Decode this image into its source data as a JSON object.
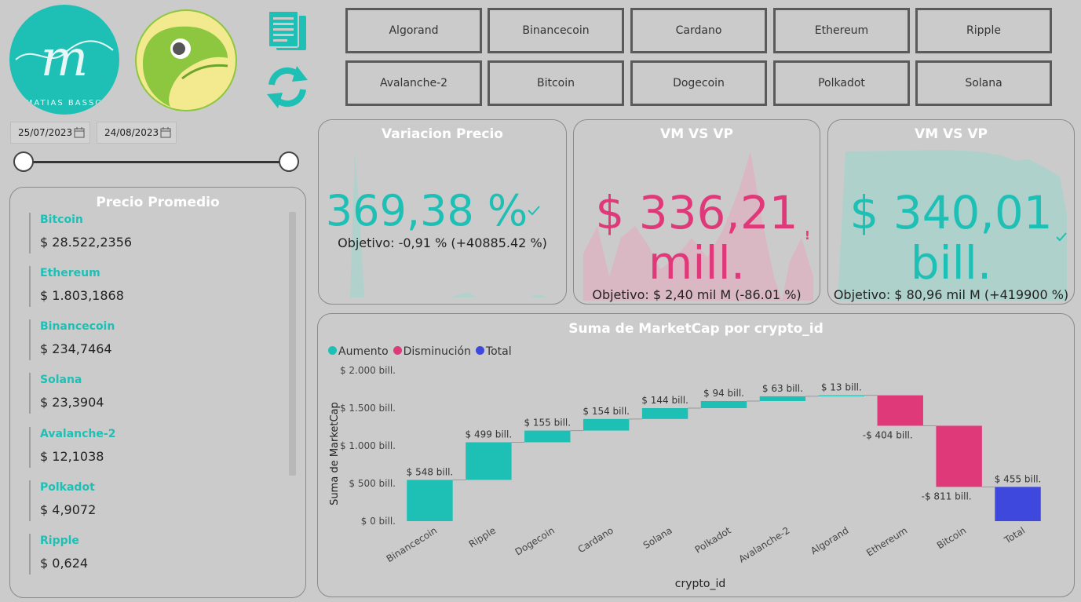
{
  "logos": {
    "author_text": "MATIAS BASSO",
    "author_initial": "m"
  },
  "crypto_buttons": {
    "row1": [
      "Algorand",
      "Binancecoin",
      "Cardano",
      "Ethereum",
      "Ripple"
    ],
    "row2": [
      "Avalanche-2",
      "Bitcoin",
      "Dogecoin",
      "Polkadot",
      "Solana"
    ]
  },
  "date_range": {
    "start": "25/07/2023",
    "end": "24/08/2023"
  },
  "precio_promedio": {
    "title": "Precio Promedio",
    "items": [
      {
        "name": "Bitcoin",
        "value": "$ 28.522,2356"
      },
      {
        "name": "Ethereum",
        "value": "$ 1.803,1868"
      },
      {
        "name": "Binancecoin",
        "value": "$ 234,7464"
      },
      {
        "name": "Solana",
        "value": "$ 23,3904"
      },
      {
        "name": "Avalanche-2",
        "value": "$ 12,1038"
      },
      {
        "name": "Polkadot",
        "value": "$ 4,9072"
      },
      {
        "name": "Ripple",
        "value": "$ 0,624"
      }
    ]
  },
  "kpi1": {
    "title": "Variacion Precio",
    "value": "369,38 %",
    "objective": "Objetivo: -0,91 % (+40885.42 %)",
    "status": "check-icon"
  },
  "kpi2": {
    "title": "VM VS VP",
    "value_line1": "$ 336,21",
    "value_line2": "mill.",
    "objective": "Objetivo: $ 2,40 mil M (-86.01 %)",
    "status": "!"
  },
  "kpi3": {
    "title": "VM VS VP",
    "value_line1": "$ 340,01",
    "value_line2": "bill.",
    "objective": "Objetivo: $ 80,96 mil M (+419900 %)",
    "status": "check-icon"
  },
  "colors": {
    "teal": "#1ec0b5",
    "pink": "#e0397a",
    "blue": "#3f48dc"
  },
  "chart_data": {
    "type": "waterfall",
    "title": "Suma de MarketCap por crypto_id",
    "xlabel": "crypto_id",
    "ylabel": "Suma de MarketCap",
    "legend": [
      {
        "name": "Aumento",
        "color": "#1ec0b5"
      },
      {
        "name": "Disminución",
        "color": "#e0397a"
      },
      {
        "name": "Total",
        "color": "#3f48dc"
      }
    ],
    "yticks": [
      "$ 0 bill.",
      "$ 500 bill.",
      "$ 1.000 bill.",
      "$ 1.500 bill.",
      "$ 2.000 bill."
    ],
    "ylim": [
      0,
      2000
    ],
    "categories": [
      "Binancecoin",
      "Ripple",
      "Dogecoin",
      "Cardano",
      "Solana",
      "Polkadot",
      "Avalanche-2",
      "Algorand",
      "Ethereum",
      "Bitcoin",
      "Total"
    ],
    "values": [
      548,
      499,
      155,
      154,
      144,
      94,
      63,
      13,
      -404,
      -811,
      455
    ],
    "labels": [
      "$ 548 bill.",
      "$ 499 bill.",
      "$ 155 bill.",
      "$ 154 bill.",
      "$ 144 bill.",
      "$ 94 bill.",
      "$ 63 bill.",
      "$ 13 bill.",
      "-$ 404 bill.",
      "-$ 811 bill.",
      "$ 455 bill."
    ],
    "kinds": [
      "up",
      "up",
      "up",
      "up",
      "up",
      "up",
      "up",
      "up",
      "down",
      "down",
      "total"
    ]
  }
}
